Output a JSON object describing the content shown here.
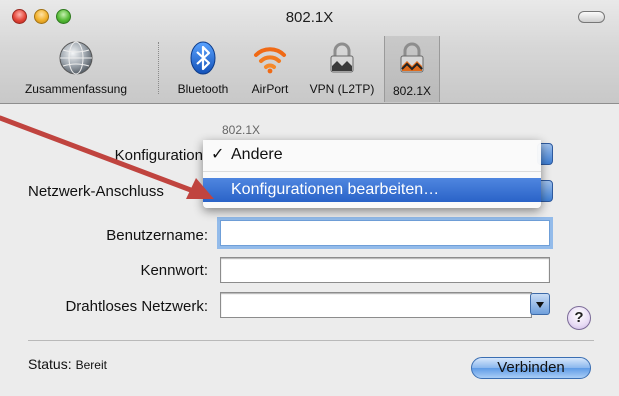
{
  "window": {
    "title": "802.1X"
  },
  "toolbar": {
    "items": [
      {
        "label": "Zusammenfassung",
        "icon": "network-globe-icon"
      },
      {
        "label": "Bluetooth",
        "icon": "bluetooth-icon"
      },
      {
        "label": "AirPort",
        "icon": "airport-wifi-icon"
      },
      {
        "label": "VPN (L2TP)",
        "icon": "vpn-lock-icon"
      },
      {
        "label": "802.1X",
        "icon": "lock-8021x-icon",
        "selected": true
      }
    ]
  },
  "form": {
    "section_label": "802.1X",
    "konfiguration_label": "Konfiguration",
    "netzwerk_label": "Netzwerk-Anschluss",
    "benutzername_label": "Benutzername:",
    "benutzername_value": "",
    "kennwort_label": "Kennwort:",
    "kennwort_value": "",
    "wireless_label": "Drahtloses Netzwerk:",
    "wireless_value": ""
  },
  "menu": {
    "items": [
      {
        "label": "Andere",
        "checked": true,
        "check_glyph": "✓"
      },
      {
        "label": "Konfigurationen bearbeiten…",
        "highlighted": true
      }
    ]
  },
  "status": {
    "label": "Status:",
    "value": "Bereit"
  },
  "buttons": {
    "connect": "Verbinden",
    "help": "?"
  },
  "colors": {
    "accent": "#2a63c8",
    "annotation_arrow": "#c0443f"
  }
}
